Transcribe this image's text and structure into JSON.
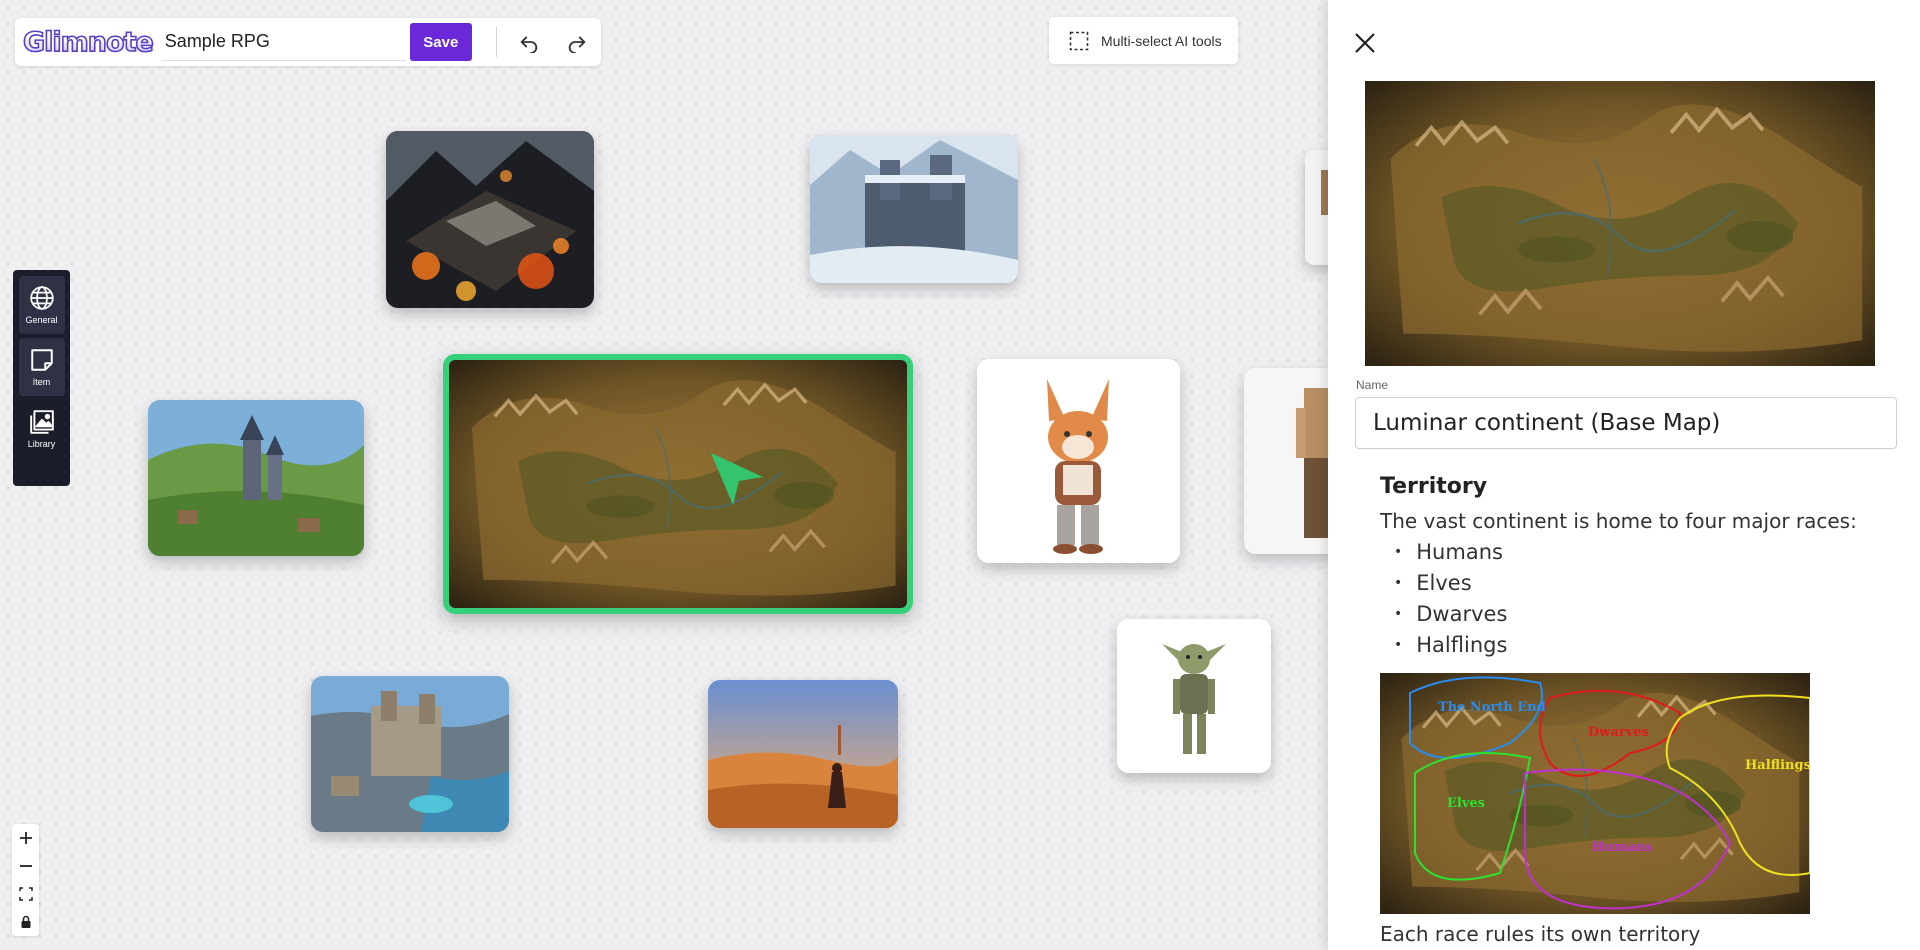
{
  "app": {
    "logo": "Glimnote",
    "project_title": "Sample RPG",
    "save_label": "Save",
    "multi_select_label": "Multi-select AI tools"
  },
  "dock": {
    "items": [
      {
        "label": "General",
        "icon": "globe-icon"
      },
      {
        "label": "Item",
        "icon": "note-icon"
      },
      {
        "label": "Library",
        "icon": "image-library-icon"
      }
    ]
  },
  "zoom": {
    "items": [
      "zoom-in-icon",
      "zoom-out-icon",
      "fit-screen-icon",
      "lock-icon"
    ]
  },
  "canvas": {
    "cards": [
      {
        "name": "volcanic-fortress-card"
      },
      {
        "name": "snow-castle-card"
      },
      {
        "name": "village-castle-card"
      },
      {
        "name": "luminar-map-card",
        "selected": true
      },
      {
        "name": "fox-character-card"
      },
      {
        "name": "human-character-card"
      },
      {
        "name": "goblin-character-card"
      },
      {
        "name": "coastal-castle-card"
      },
      {
        "name": "desert-traveler-card"
      }
    ],
    "selection_color": "#36d07b"
  },
  "panel": {
    "name_label": "Name",
    "name_value": "Luminar continent (Base Map)",
    "heading": "Territory",
    "intro": "The vast continent is home to four major races:",
    "races": [
      "Humans",
      "Elves",
      "Dwarves",
      "Halflings"
    ],
    "territory_labels": {
      "north": "The North End",
      "dwarves": "Dwarves",
      "halflings": "Halflings",
      "elves": "Elves",
      "humans": "Humans"
    },
    "trailing_text": "Each race rules its own territory"
  },
  "colors": {
    "accent": "#6a28d9",
    "dock_bg": "#1c1d2a"
  }
}
